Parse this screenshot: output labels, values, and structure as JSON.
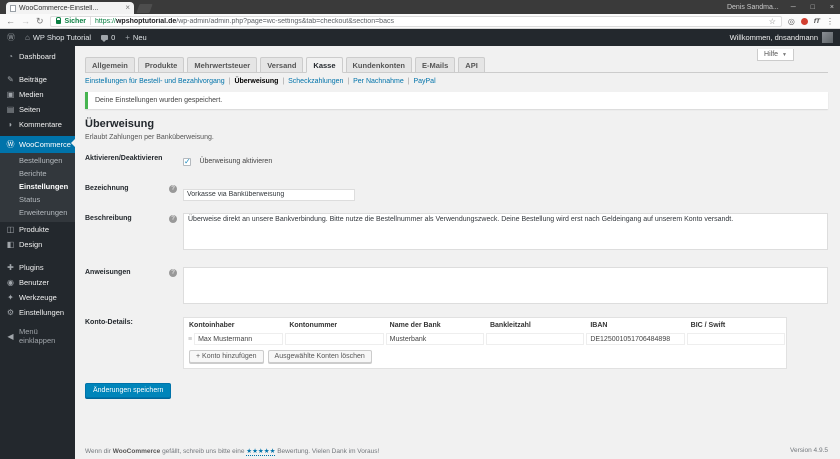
{
  "browser": {
    "tab_title": "WooCommerce-Einstell...",
    "profile": "Denis Sandma...",
    "controls": {
      "minimize": "─",
      "maximize": "□",
      "close": "×",
      "close_tab": "×"
    },
    "nav": {
      "back": "←",
      "forward": "→",
      "reload": "↻"
    },
    "security": "Sicher",
    "url": {
      "scheme": "https://",
      "domain": "wpshoptutorial.de",
      "path": "/wp-admin/admin.php?page=wc-settings&tab=checkout&section=bacs"
    },
    "bookmark_star": "☆",
    "extension_label": "fT",
    "menu_icon": "⋮"
  },
  "admin_bar": {
    "wp_logo": "Ⓦ",
    "home_icon": "⌂",
    "site": "WP Shop Tutorial",
    "comments": "0",
    "new_icon": "+",
    "new_label": "Neu",
    "welcome": "Willkommen, dnsandmann"
  },
  "sidebar": {
    "items": [
      {
        "label": "Dashboard",
        "icon": "◔"
      },
      {
        "label": "Beiträge",
        "icon": "✎"
      },
      {
        "label": "Medien",
        "icon": "▣"
      },
      {
        "label": "Seiten",
        "icon": "▤"
      },
      {
        "label": "Kommentare",
        "icon": "◗"
      },
      {
        "label": "WooCommerce",
        "icon": "Ⓦ"
      },
      {
        "label": "Produkte",
        "icon": "◫"
      },
      {
        "label": "Design",
        "icon": "◧"
      },
      {
        "label": "Plugins",
        "icon": "✚"
      },
      {
        "label": "Benutzer",
        "icon": "◉"
      },
      {
        "label": "Werkzeuge",
        "icon": "✦"
      },
      {
        "label": "Einstellungen",
        "icon": "⚙"
      },
      {
        "label": "Menü einklappen",
        "icon": "◀"
      }
    ],
    "woocommerce_submenu": [
      {
        "label": "Bestellungen"
      },
      {
        "label": "Berichte"
      },
      {
        "label": "Einstellungen"
      },
      {
        "label": "Status"
      },
      {
        "label": "Erweiterungen"
      }
    ]
  },
  "help_button": {
    "label": "Hilfe"
  },
  "tabs": {
    "items": [
      "Allgemein",
      "Produkte",
      "Mehrwertsteuer",
      "Versand",
      "Kasse",
      "Kundenkonten",
      "E-Mails",
      "API"
    ]
  },
  "subnav": {
    "items": [
      "Einstellungen für Bestell- und Bezahlvorgang",
      "Überweisung",
      "Scheckzahlungen",
      "Per Nachnahme",
      "PayPal"
    ],
    "separator": "|"
  },
  "notice": "Deine Einstellungen wurden gespeichert.",
  "page": {
    "title": "Überweisung",
    "subtitle": "Erlaubt Zahlungen per Banküberweisung."
  },
  "form": {
    "enable": {
      "label": "Aktivieren/Deaktivieren",
      "checkbox_label": "Überweisung aktivieren",
      "checked": true
    },
    "title": {
      "label": "Bezeichnung",
      "value": "Vorkasse via Banküberweisung"
    },
    "description": {
      "label": "Beschreibung",
      "value": "Überweise direkt an unsere Bankverbindung. Bitte nutze die Bestellnummer als Verwendungszweck. Deine Bestellung wird erst nach Geldeingang auf unserem Konto versandt."
    },
    "instructions": {
      "label": "Anweisungen",
      "value": ""
    },
    "accounts": {
      "label": "Konto-Details:",
      "columns": [
        "Kontoinhaber",
        "Kontonummer",
        "Name der Bank",
        "Bankleitzahl",
        "IBAN",
        "BIC / Swift"
      ],
      "rows": [
        {
          "account_name": "Max Mustermann",
          "account_number": "",
          "bank_name": "Musterbank",
          "sort_code": "",
          "iban": "DE125001051706484898",
          "bic": ""
        }
      ],
      "add_button": "+ Konto hinzufügen",
      "delete_button": "Ausgewählte Konten löschen"
    },
    "save_button": "Änderungen speichern"
  },
  "footer": {
    "left_pre": "Wenn dir ",
    "brand": "WooCommerce",
    "left_mid": " gefällt, schreib uns bitte eine ",
    "stars": "★★★★★",
    "left_post": " Bewertung. Vielen Dank im Voraus!",
    "version": "Version 4.9.5"
  },
  "colors": {
    "accent": "#0073aa",
    "primary_button": "#0085ba",
    "success": "#46b450",
    "admin_dark": "#23282d"
  }
}
